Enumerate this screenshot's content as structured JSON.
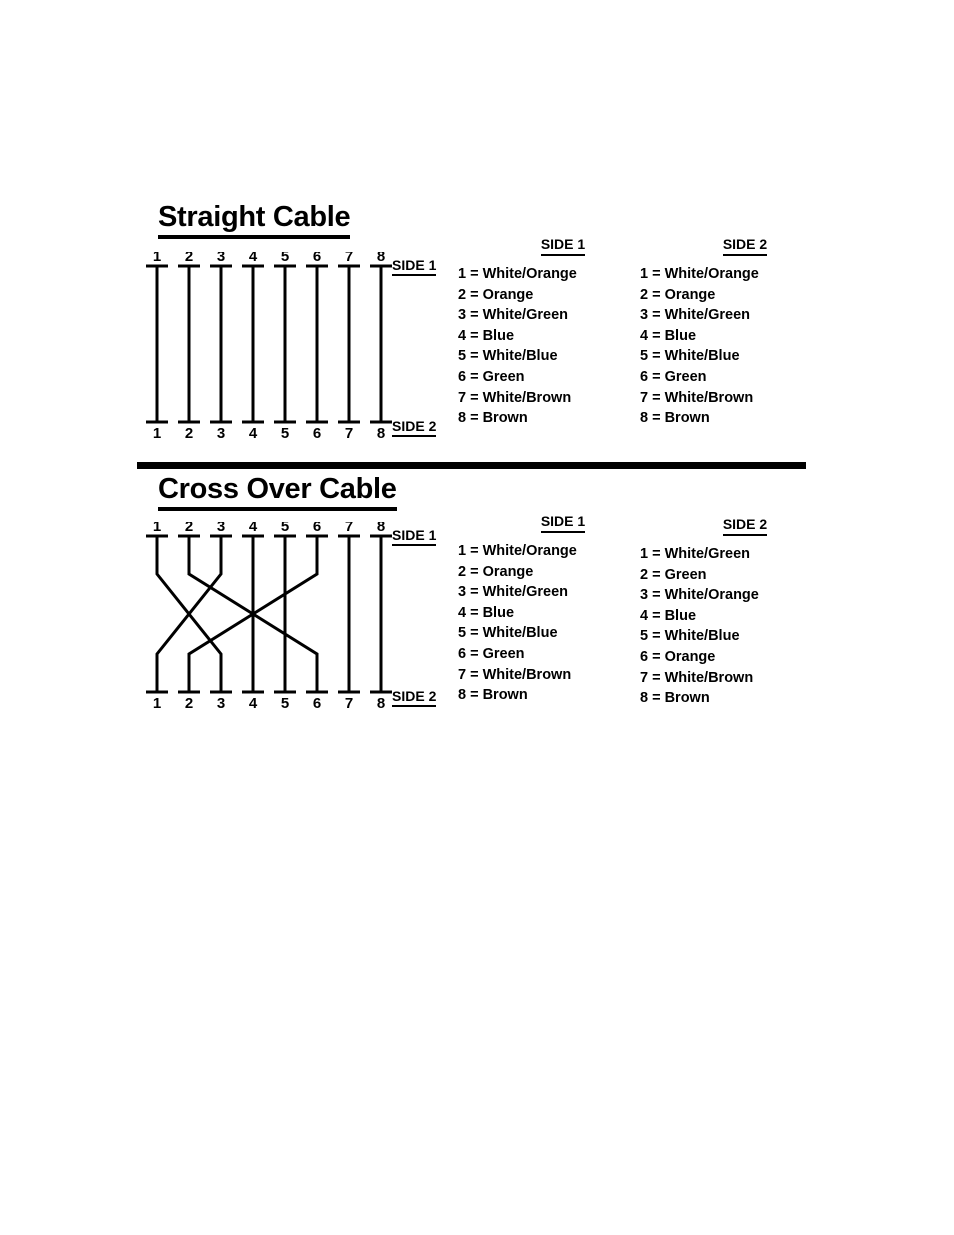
{
  "document": {
    "sections": [
      {
        "id": "straight",
        "title": "Straight Cable",
        "diagram": {
          "top_side_label": "SIDE 1",
          "bottom_side_label": "SIDE 2",
          "pins_top": [
            "1",
            "2",
            "3",
            "4",
            "5",
            "6",
            "7",
            "8"
          ],
          "pins_bottom": [
            "1",
            "2",
            "3",
            "4",
            "5",
            "6",
            "7",
            "8"
          ],
          "mapping": [
            {
              "from": 1,
              "to": 1
            },
            {
              "from": 2,
              "to": 2
            },
            {
              "from": 3,
              "to": 3
            },
            {
              "from": 4,
              "to": 4
            },
            {
              "from": 5,
              "to": 5
            },
            {
              "from": 6,
              "to": 6
            },
            {
              "from": 7,
              "to": 7
            },
            {
              "from": 8,
              "to": 8
            }
          ]
        },
        "legends": [
          {
            "heading": "SIDE 1",
            "items": [
              "1 = White/Orange",
              "2 = Orange",
              "3 = White/Green",
              "4 = Blue",
              "5 = White/Blue",
              "6 = Green",
              "7 = White/Brown",
              "8 = Brown"
            ]
          },
          {
            "heading": "SIDE 2",
            "items": [
              "1 = White/Orange",
              "2 = Orange",
              "3 = White/Green",
              "4 = Blue",
              "5 = White/Blue",
              "6 = Green",
              "7 = White/Brown",
              "8 = Brown"
            ]
          }
        ]
      },
      {
        "id": "crossover",
        "title": "Cross Over Cable",
        "diagram": {
          "top_side_label": "SIDE 1",
          "bottom_side_label": "SIDE 2",
          "pins_top": [
            "1",
            "2",
            "3",
            "4",
            "5",
            "6",
            "7",
            "8"
          ],
          "pins_bottom": [
            "1",
            "2",
            "3",
            "4",
            "5",
            "6",
            "7",
            "8"
          ],
          "mapping": [
            {
              "from": 1,
              "to": 3
            },
            {
              "from": 2,
              "to": 6
            },
            {
              "from": 3,
              "to": 1
            },
            {
              "from": 4,
              "to": 4
            },
            {
              "from": 5,
              "to": 5
            },
            {
              "from": 6,
              "to": 2
            },
            {
              "from": 7,
              "to": 7
            },
            {
              "from": 8,
              "to": 8
            }
          ]
        },
        "legends": [
          {
            "heading": "SIDE 1",
            "items": [
              "1 = White/Orange",
              "2 = Orange",
              "3 = White/Green",
              "4 = Blue",
              "5 = White/Blue",
              "6 = Green",
              "7 = White/Brown",
              "8 = Brown"
            ]
          },
          {
            "heading": "SIDE 2",
            "items": [
              "1 = White/Green",
              "2 = Green",
              "3 = White/Orange",
              "4 = Blue",
              "5 = White/Blue",
              "6 = Orange",
              "7 = White/Brown",
              "8 = Brown"
            ]
          }
        ]
      }
    ]
  }
}
